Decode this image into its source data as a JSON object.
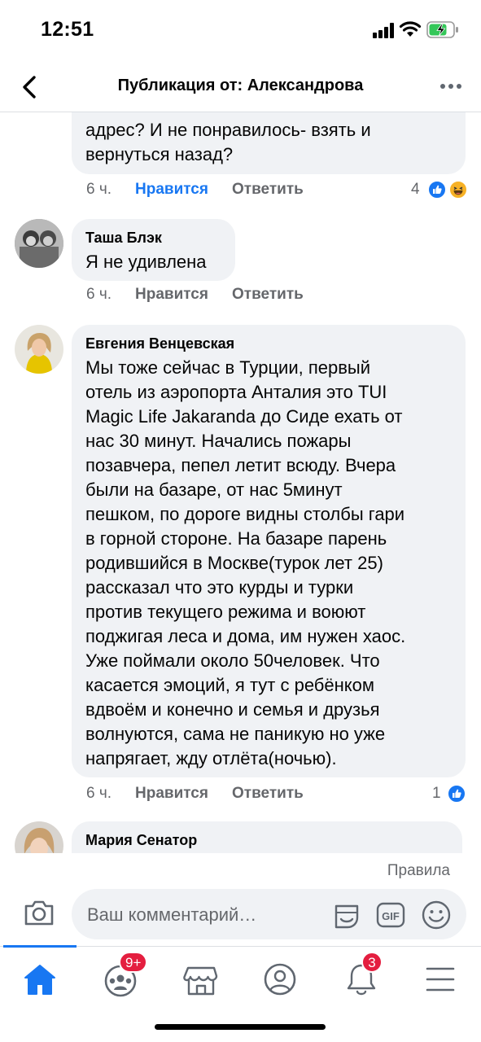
{
  "status_bar": {
    "time": "12:51"
  },
  "header": {
    "title": "Публикация от: Александрова"
  },
  "comments": [
    {
      "text": "адрес? И не понравилось- взять и\nвернуться назад?",
      "time": "6 ч.",
      "like_label": "Нравится",
      "reply_label": "Ответить",
      "reaction_count": "4"
    },
    {
      "author": "Таша Блэк",
      "text": "Я не удивлена",
      "time": "6 ч.",
      "like_label": "Нравится",
      "reply_label": "Ответить"
    },
    {
      "author": "Евгения Венцевская",
      "text": "Мы тоже сейчас в Турции, первый\nотель из аэропорта Анталия это TUI\nMagic Life Jakaranda до Сиде ехать от\nнас 30 минут. Начались пожары\nпозавчера, пепел летит всюду. Вчера\nбыли на базаре, от нас 5минут\nпешком, по дороге видны столбы гари\nв горной стороне. На базаре парень\nродившийся в Москве(турок лет 25)\nрассказал что это курды и турки\nпротив текущего режима и воюют\nподжигая леса и дома, им нужен хаос.\nУже поймали около 50человек. Что\nкасается эмоций, я тут с ребёнком\nвдвоём и конечно и семья и друзья\nволнуются, сама не паникую но уже\nнапрягает, жду отлёта(ночью).",
      "time": "6 ч.",
      "like_label": "Нравится",
      "reply_label": "Ответить",
      "reaction_count": "1"
    },
    {
      "author": "Мария Сенатор"
    }
  ],
  "composer": {
    "rules_link": "Правила",
    "placeholder": "Ваш комментарий…"
  },
  "tabs": {
    "groups_badge": "9+",
    "notifications_badge": "3"
  },
  "colors": {
    "accent": "#1877f2",
    "badge": "#e41e3f",
    "bubble": "#f0f2f5",
    "secondary_text": "#65676b"
  },
  "icons": [
    "back-arrow-icon",
    "more-icon",
    "like-reaction-icon",
    "haha-reaction-icon",
    "camera-icon",
    "sticker-icon",
    "gif-icon",
    "emoji-icon",
    "home-icon",
    "groups-icon",
    "marketplace-icon",
    "profile-icon",
    "bell-icon",
    "menu-icon"
  ]
}
